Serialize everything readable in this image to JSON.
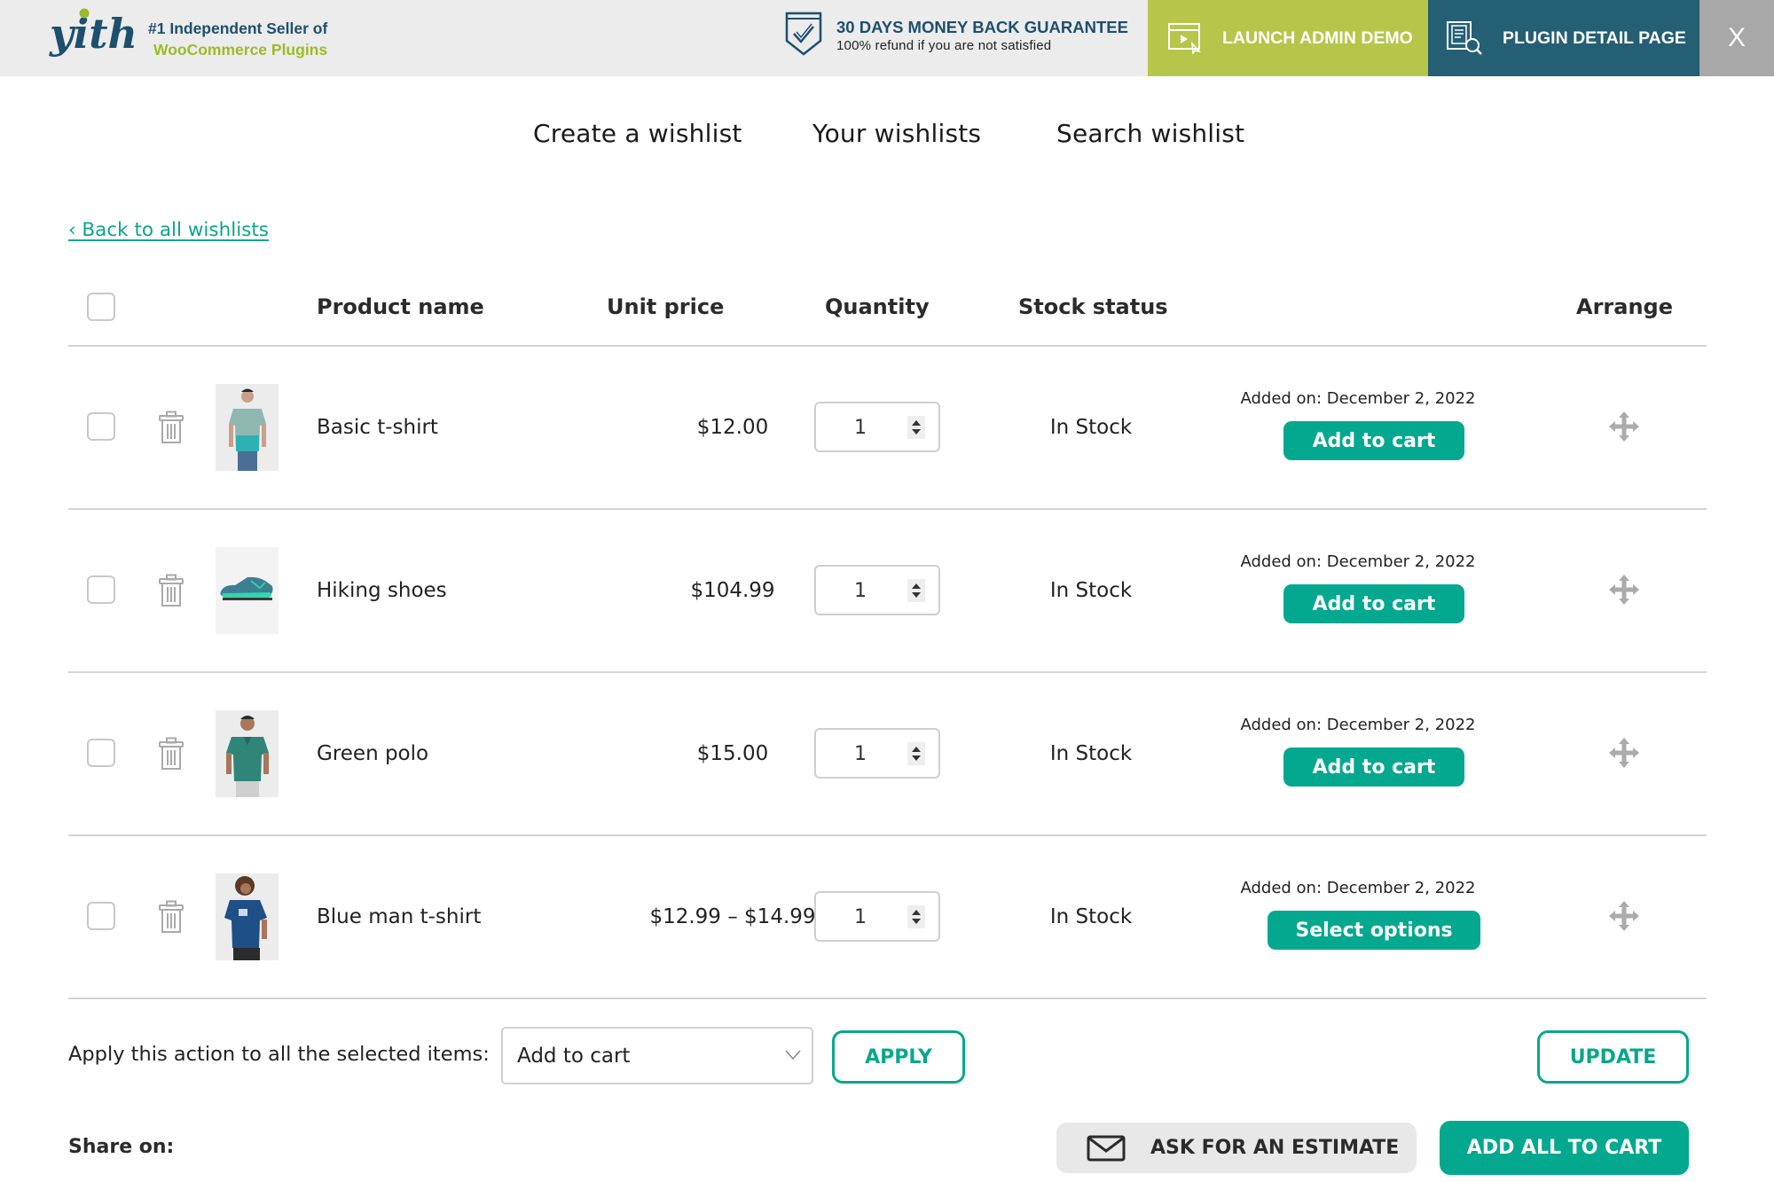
{
  "topbar": {
    "tagline_line1": "#1 Independent Seller of",
    "tagline_line2": "WooCommerce Plugins",
    "guarantee_title": "30 DAYS MONEY BACK GUARANTEE",
    "guarantee_subtitle": "100% refund if you are not satisfied",
    "launch_demo_label": "LAUNCH ADMIN DEMO",
    "plugin_detail_label": "PLUGIN DETAIL PAGE",
    "close_label": "X",
    "colors": {
      "logo_blue": "#1d4f6e",
      "logo_green": "#9bbb2a",
      "demo_bg": "#b5c64a",
      "plugin_bg": "#255f74",
      "close_bg": "#a8a8a8"
    }
  },
  "wishlist_nav": {
    "items": [
      {
        "label": "Create a wishlist"
      },
      {
        "label": "Your wishlists"
      },
      {
        "label": "Search wishlist"
      }
    ]
  },
  "back_link": "‹ Back to all wishlists",
  "table": {
    "headers": {
      "product_name": "Product name",
      "unit_price": "Unit price",
      "quantity": "Quantity",
      "stock_status": "Stock status",
      "arrange": "Arrange"
    },
    "rows": [
      {
        "name": "Basic t-shirt",
        "price": "$12.00",
        "quantity": "1",
        "stock": "In Stock",
        "added_on": "Added on: December 2, 2022",
        "action": "Add to cart",
        "image": "t-shirt-photo"
      },
      {
        "name": "Hiking shoes",
        "price": "$104.99",
        "quantity": "1",
        "stock": "In Stock",
        "added_on": "Added on: December 2, 2022",
        "action": "Add to cart",
        "image": "shoe-photo"
      },
      {
        "name": "Green polo",
        "price": "$15.00",
        "quantity": "1",
        "stock": "In Stock",
        "added_on": "Added on: December 2, 2022",
        "action": "Add to cart",
        "image": "polo-photo"
      },
      {
        "name": "Blue man t-shirt",
        "price": "$12.99 – $14.99",
        "quantity": "1",
        "stock": "In Stock",
        "added_on": "Added on: December 2, 2022",
        "action": "Select options",
        "image": "blue-tshirt-photo"
      }
    ]
  },
  "bulk_actions": {
    "label": "Apply this action to all the selected items:",
    "selected_option": "Add to cart",
    "apply_label": "APPLY",
    "update_label": "UPDATE"
  },
  "footer": {
    "share_label": "Share on:",
    "estimate_label": "ASK FOR AN ESTIMATE",
    "add_all_label": "ADD ALL TO CART"
  },
  "accent_color": "#0aa68c"
}
